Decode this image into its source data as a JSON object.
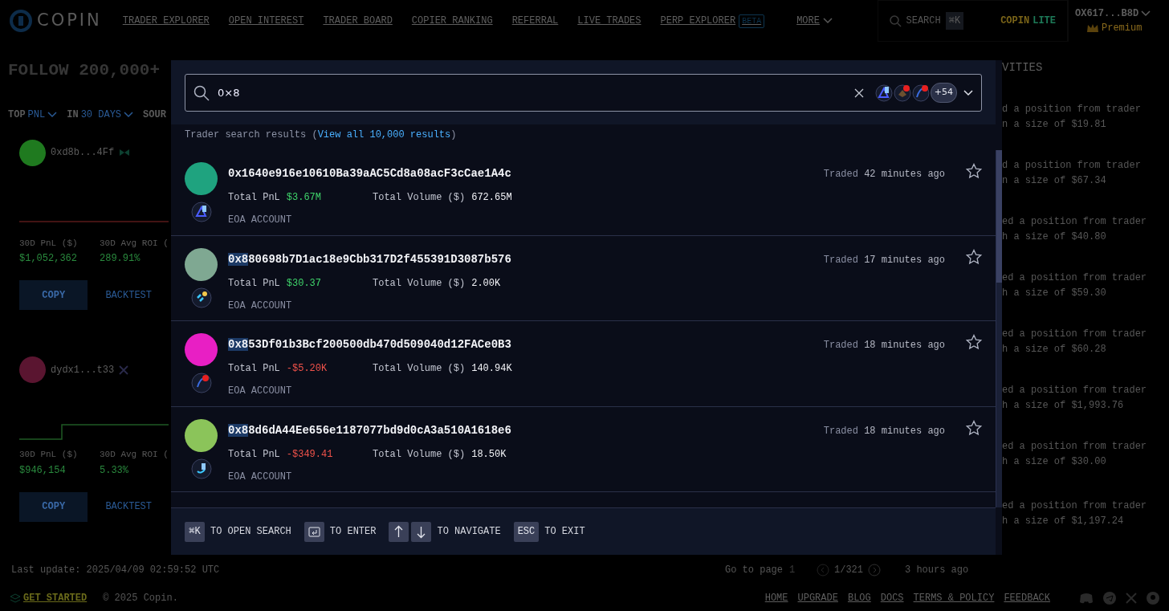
{
  "header": {
    "logo": "COPIN",
    "nav": [
      {
        "label": "TRADER EXPLORER"
      },
      {
        "label": "OPEN INTEREST"
      },
      {
        "label": "TRADER BOARD"
      },
      {
        "label": "COPIER RANKING"
      },
      {
        "label": "REFERRAL"
      },
      {
        "label": "LIVE TRADES"
      },
      {
        "label": "PERP EXPLORER",
        "badge": "BETA"
      },
      {
        "label": "MORE",
        "dropdown": true
      }
    ],
    "search": {
      "placeholder": "SEARCH",
      "shortcut": "⌘K"
    },
    "lite_button": {
      "brand": "COPIN",
      "label": "LITE"
    },
    "account": {
      "address": "OX617...B8D",
      "plan": "Premium"
    }
  },
  "page": {
    "title": "FOLLOW 200,000+",
    "filters": [
      {
        "prefix": "TOP",
        "value": "PNL"
      },
      {
        "prefix": "IN",
        "value": "30 DAYS"
      },
      {
        "prefix": "SOUR"
      }
    ],
    "traders": [
      {
        "address": "0xd8b...4Ff",
        "color": "#1f7a1f",
        "stats": [
          {
            "label": "30D PnL ($)",
            "value": "$1,052,362"
          },
          {
            "label": "30D Avg ROI (",
            "value": "289.91%"
          }
        ],
        "copy": "COPY",
        "backtest": "BACKTEST"
      },
      {
        "address": "dydx1...t33",
        "color": "#5a1530",
        "stats": [
          {
            "label": "30D PnL ($)",
            "value": "$946,154"
          },
          {
            "label": "30D Avg ROI (",
            "value": "5.33%"
          }
        ],
        "copy": "COPY",
        "backtest": "BACKTEST"
      }
    ],
    "last_update": "Last update: 2025/04/09 02:59:52 UTC",
    "pagination": {
      "label": "Go to page",
      "page": "1",
      "total": "1/321"
    },
    "last_trade": "3 hours ago",
    "activities": {
      "title": "VITIES",
      "items": [
        {
          "action": "d a position from trader",
          "size": "n a size of $19.81"
        },
        {
          "action": "d a position from trader",
          "size": "n a size of $67.34"
        },
        {
          "action": "ed a position from trader",
          "size": "h a size of $40.80"
        },
        {
          "action": "ed a position from trader",
          "size": "h a size of $59.30"
        },
        {
          "action": "ed a position from trader",
          "size": "h a size of $60.28"
        },
        {
          "action": "ed a position from trader",
          "size": "h a size of $1,993.76"
        },
        {
          "action": "ed a position from trader",
          "size": "h a size of $30.00"
        },
        {
          "action": "ed a position from trader",
          "size": "h a size of $1,197.24"
        }
      ]
    }
  },
  "search_modal": {
    "query": "0×8",
    "protocols_more": "+54",
    "summary": {
      "before": "Trader search results (",
      "link": "View all 10,000 results",
      "after": ")"
    },
    "results": [
      {
        "address_rest": "0x1640e916e10610Ba39aAC5Cd8a08acF3cCae1A4c",
        "color": "#1fa37f",
        "pnl_label": "Total PnL",
        "pnl": {
          "text": "$3.67M",
          "color": "#3fd36a"
        },
        "volume_label": "Total Volume ($)",
        "volume": "672.65M",
        "account_type": "EOA ACCOUNT",
        "traded_label": "Traded",
        "traded_time": "42 minutes ago",
        "favorite": false
      },
      {
        "address_match": "0x8",
        "address_rest": "80698b7D1ac18e9Cbb317D2f455391D3087b576",
        "color": "#7fa892",
        "pnl_label": "Total PnL",
        "pnl": {
          "text": "$30.37",
          "color": "#3fd36a"
        },
        "volume_label": "Total Volume ($)",
        "volume": "2.00K",
        "account_type": "EOA ACCOUNT",
        "traded_label": "Traded",
        "traded_time": "17 minutes ago",
        "favorite": false
      },
      {
        "address_match": "0x8",
        "address_rest": "53Df01b3Bcf200500db470d509040d12FACe0B3",
        "color": "#e81fc4",
        "pnl_label": "Total PnL",
        "pnl": {
          "text": "-$5.20K",
          "color": "#f0524a"
        },
        "volume_label": "Total Volume ($)",
        "volume": "140.94K",
        "account_type": "EOA ACCOUNT",
        "traded_label": "Traded",
        "traded_time": "18 minutes ago",
        "favorite": false
      },
      {
        "address_match": "0x8",
        "address_rest": "8d6dA44Ee656e1187077bd9d0cA3a510A1618e6",
        "color": "#8bc45a",
        "pnl_label": "Total PnL",
        "pnl": {
          "text": "-$349.41",
          "color": "#f0524a"
        },
        "volume_label": "Total Volume ($)",
        "volume": "18.50K",
        "account_type": "EOA ACCOUNT",
        "traded_label": "Traded",
        "traded_time": "18 minutes ago",
        "favorite": false
      }
    ],
    "shortcuts": [
      {
        "keys": [
          {
            "kind": "text",
            "text": "⌘K"
          }
        ],
        "label": "TO OPEN SEARCH"
      },
      {
        "keys": [
          {
            "kind": "enter"
          }
        ],
        "label": "TO ENTER"
      },
      {
        "keys": [
          {
            "kind": "up"
          },
          {
            "kind": "down"
          }
        ],
        "label": "TO NAVIGATE"
      },
      {
        "keys": [
          {
            "kind": "text",
            "text": "ESC"
          }
        ],
        "label": "TO EXIT"
      }
    ]
  },
  "footer": {
    "get_started": "GET STARTED",
    "copyright": "© 2025 Copin.",
    "links": [
      "HOME",
      "UPGRADE",
      "BLOG",
      "DOCS",
      "TERMS & POLICY",
      "FEEDBACK"
    ]
  }
}
